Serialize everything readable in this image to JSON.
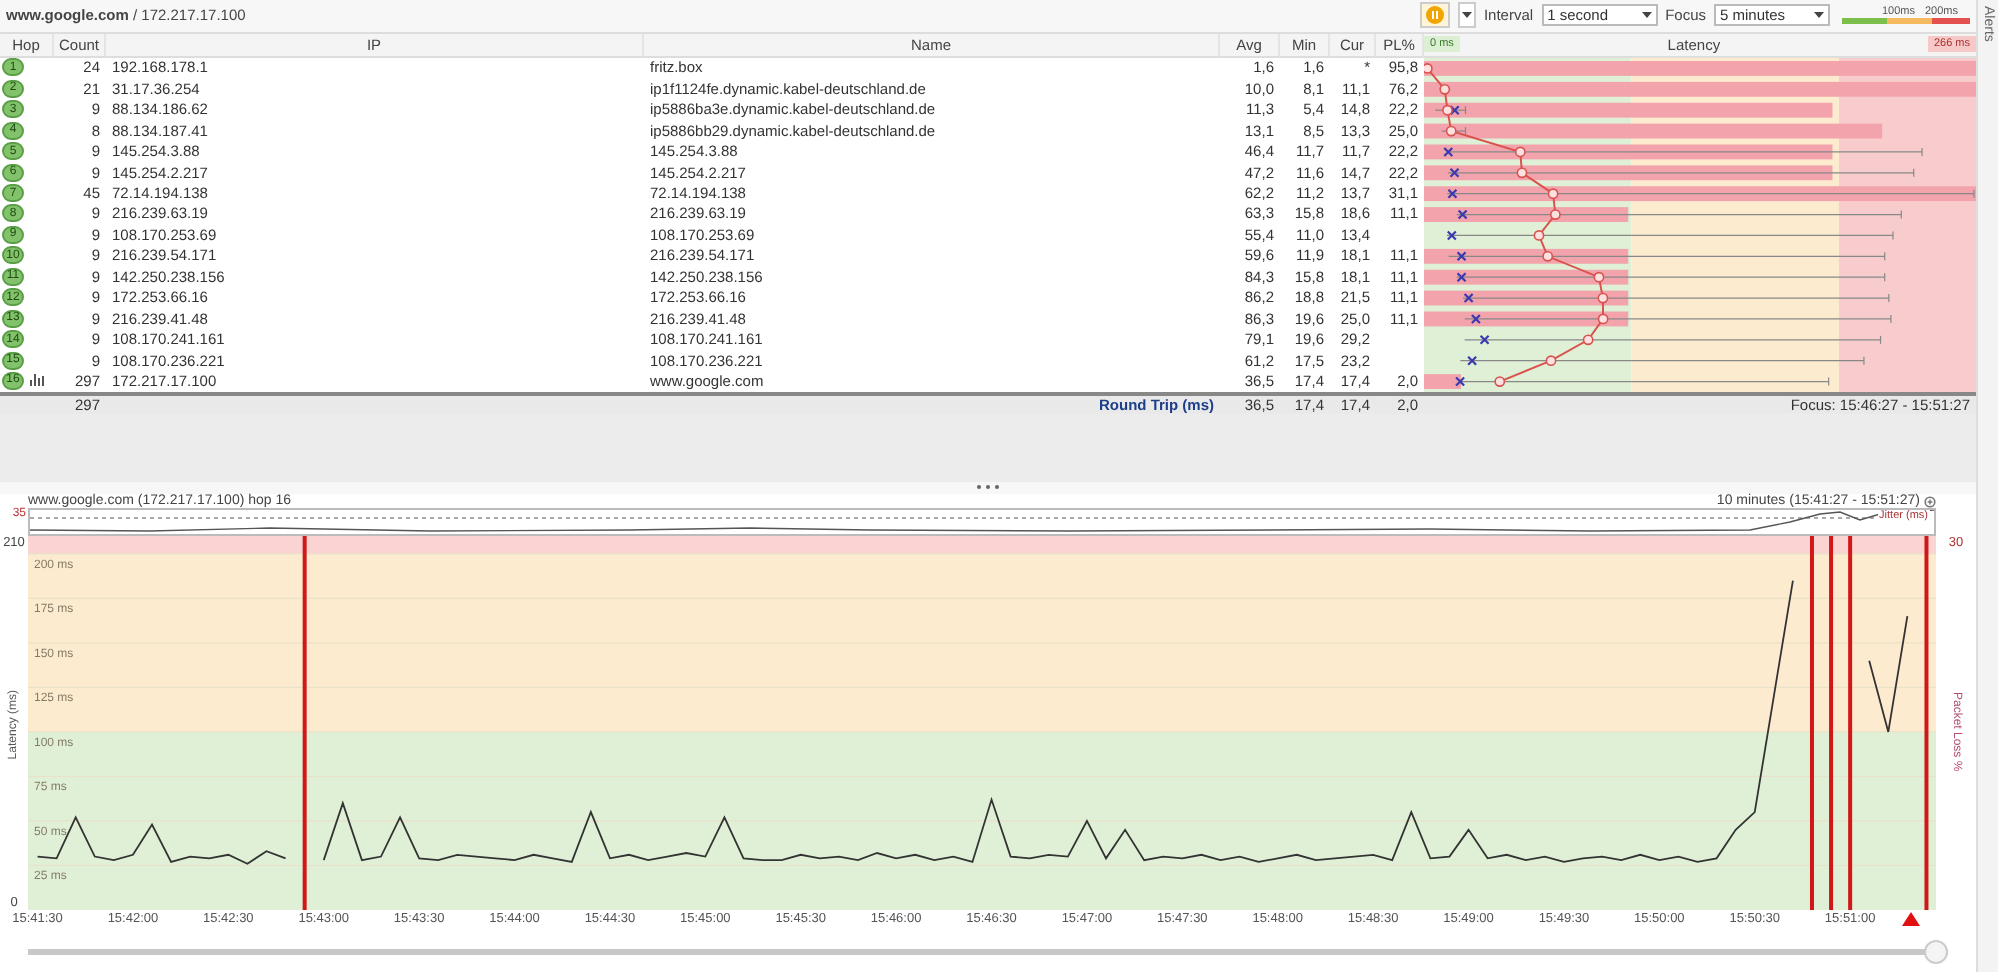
{
  "header": {
    "title": "**www.google.com** / 172.217.17.100",
    "interval_label": "Interval",
    "interval": "1 second",
    "focus_label": "Focus",
    "focus": "5 minutes",
    "legend": [
      "100ms",
      "200ms"
    ]
  },
  "alerts": "Alerts",
  "table": {
    "columns": [
      "Hop",
      "Count",
      "IP",
      "Name",
      "Avg",
      "Min",
      "Cur",
      "PL%"
    ],
    "rows": [
      {
        "hop": "1",
        "count": "24",
        "ip": "192.168.178.1",
        "name": "fritz.box",
        "avg": "1,6",
        "min": "1,6",
        "cur": "*",
        "pl": "95,8",
        "level": 1,
        "graphed": false
      },
      {
        "hop": "2",
        "count": "21",
        "ip": "31.17.36.254",
        "name": "ip1f1124fe.dynamic.kabel-deutschland.de",
        "avg": "10,0",
        "min": "8,1",
        "cur": "11,1",
        "pl": "76,2",
        "level": 1,
        "graphed": false
      },
      {
        "hop": "3",
        "count": "9",
        "ip": "88.134.186.62",
        "name": "ip5886ba3e.dynamic.kabel-deutschland.de",
        "avg": "11,3",
        "min": "5,4",
        "cur": "14,8",
        "pl": "22,2",
        "level": 0.74,
        "graphed": false
      },
      {
        "hop": "4",
        "count": "8",
        "ip": "88.134.187.41",
        "name": "ip5886bb29.dynamic.kabel-deutschland.de",
        "avg": "13,1",
        "min": "8,5",
        "cur": "13,3",
        "pl": "25,0",
        "level": 0.83,
        "graphed": false
      },
      {
        "hop": "5",
        "count": "9",
        "ip": "145.254.3.88",
        "name": "145.254.3.88",
        "avg": "46,4",
        "min": "11,7",
        "cur": "11,7",
        "pl": "22,2",
        "level": 0.74,
        "graphed": false
      },
      {
        "hop": "6",
        "count": "9",
        "ip": "145.254.2.217",
        "name": "145.254.2.217",
        "avg": "47,2",
        "min": "11,6",
        "cur": "14,7",
        "pl": "22,2",
        "level": 0.74,
        "graphed": false
      },
      {
        "hop": "7",
        "count": "45",
        "ip": "72.14.194.138",
        "name": "72.14.194.138",
        "avg": "62,2",
        "min": "11,2",
        "cur": "13,7",
        "pl": "31,1",
        "level": 1,
        "graphed": false
      },
      {
        "hop": "8",
        "count": "9",
        "ip": "216.239.63.19",
        "name": "216.239.63.19",
        "avg": "63,3",
        "min": "15,8",
        "cur": "18,6",
        "pl": "11,1",
        "level": 0.37,
        "graphed": false
      },
      {
        "hop": "9",
        "count": "9",
        "ip": "108.170.253.69",
        "name": "108.170.253.69",
        "avg": "55,4",
        "min": "11,0",
        "cur": "13,4",
        "level": 0,
        "graphed": false
      },
      {
        "hop": "10",
        "count": "9",
        "ip": "216.239.54.171",
        "name": "216.239.54.171",
        "avg": "59,6",
        "min": "11,9",
        "cur": "18,1",
        "pl": "11,1",
        "level": 0.37,
        "graphed": false
      },
      {
        "hop": "11",
        "count": "9",
        "ip": "142.250.238.156",
        "name": "142.250.238.156",
        "avg": "84,3",
        "min": "15,8",
        "cur": "18,1",
        "pl": "11,1",
        "level": 0.37,
        "graphed": false
      },
      {
        "hop": "12",
        "count": "9",
        "ip": "172.253.66.16",
        "name": "172.253.66.16",
        "avg": "86,2",
        "min": "18,8",
        "cur": "21,5",
        "pl": "11,1",
        "level": 0.37,
        "graphed": false
      },
      {
        "hop": "13",
        "count": "9",
        "ip": "216.239.41.48",
        "name": "216.239.41.48",
        "avg": "86,3",
        "min": "19,6",
        "cur": "25,0",
        "pl": "11,1",
        "level": 0.37,
        "graphed": false
      },
      {
        "hop": "14",
        "count": "9",
        "ip": "108.170.241.161",
        "name": "108.170.241.161",
        "avg": "79,1",
        "min": "19,6",
        "cur": "29,2",
        "level": 0,
        "graphed": false
      },
      {
        "hop": "15",
        "count": "9",
        "ip": "108.170.236.221",
        "name": "108.170.236.221",
        "avg": "61,2",
        "min": "17,5",
        "cur": "23,2",
        "level": 0,
        "graphed": false
      },
      {
        "hop": "16",
        "count": "297",
        "ip": "172.217.17.100",
        "name": "www.google.com",
        "avg": "36,5",
        "min": "17,4",
        "cur": "17,4",
        "pl": "2,0",
        "level": 0.067,
        "graphed": true
      }
    ],
    "latency_title": "Latency",
    "scale_start": "0 ms",
    "scale_end": "266 ms"
  },
  "summary": {
    "count": "297",
    "label": "Round Trip (ms)",
    "avg": "36,5",
    "min": "17,4",
    "cur": "17,4",
    "pl": "2,0",
    "focus": "Focus: 15:46:27 - 15:51:27"
  },
  "graph": {
    "title": "www.google.com (172.217.17.100) hop 16",
    "range": "10 minutes (15:41:27 - 15:51:27)",
    "jitter_label": "Jitter (ms)",
    "jitter_max": "35",
    "packet_loss_label": "Packet Loss %",
    "packet_loss_max": "30",
    "axis_max": "210",
    "axis_min": "0",
    "chart_data": {
      "type": "line",
      "ylabel": "Latency (ms)",
      "ylim": [
        0,
        210
      ],
      "grid": true,
      "yticks": [
        {
          "value": 25,
          "label": "25 ms"
        },
        {
          "value": 50,
          "label": "50 ms"
        },
        {
          "value": 75,
          "label": "75 ms"
        },
        {
          "value": 100,
          "label": "100 ms"
        },
        {
          "value": 125,
          "label": "125 ms"
        },
        {
          "value": 150,
          "label": "150 ms"
        },
        {
          "value": 175,
          "label": "175 ms"
        },
        {
          "value": 200,
          "label": "200 ms"
        }
      ],
      "categories": [
        "15:41:30",
        null,
        null,
        null,
        null,
        "15:42:00",
        null,
        null,
        null,
        null,
        "15:42:30",
        null,
        null,
        null,
        null,
        "15:43:00",
        null,
        null,
        null,
        null,
        "15:43:30",
        null,
        null,
        null,
        null,
        "15:44:00",
        null,
        null,
        null,
        null,
        "15:44:30",
        null,
        null,
        null,
        null,
        "15:45:00",
        null,
        null,
        null,
        null,
        "15:45:30",
        null,
        null,
        null,
        null,
        "15:46:00",
        null,
        null,
        null,
        null,
        "15:46:30",
        null,
        null,
        null,
        null,
        "15:47:00",
        null,
        null,
        null,
        null,
        "15:47:30",
        null,
        null,
        null,
        null,
        "15:48:00",
        null,
        null,
        null,
        null,
        "15:48:30",
        null,
        null,
        null,
        null,
        "15:49:00",
        null,
        null,
        null,
        null,
        "15:49:30",
        null,
        null,
        null,
        null,
        "15:50:00",
        null,
        null,
        null,
        null,
        "15:50:30",
        null,
        null,
        null,
        null,
        "15:51:00",
        null,
        null,
        null,
        null
      ],
      "series": [
        {
          "color": "#333333",
          "values": [
            30,
            29,
            52,
            30,
            28,
            31,
            48,
            27,
            30,
            29,
            31,
            26,
            33,
            29,
            null,
            28,
            60,
            28,
            30,
            52,
            29,
            28,
            31,
            30,
            29,
            28,
            31,
            29,
            27,
            55,
            29,
            31,
            28,
            30,
            32,
            30,
            52,
            29,
            28,
            28,
            31,
            29,
            30,
            28,
            32,
            29,
            31,
            28,
            30,
            27,
            62,
            30,
            29,
            31,
            30,
            50,
            29,
            45,
            28,
            30,
            29,
            31,
            28,
            30,
            27,
            29,
            31,
            28,
            29,
            30,
            31,
            28,
            55,
            29,
            30,
            45,
            29,
            31,
            28,
            30,
            27,
            29,
            30,
            28,
            31,
            28,
            30,
            27,
            29,
            45,
            55,
            120,
            185,
            null,
            null,
            null,
            140,
            100,
            165,
            null
          ]
        }
      ]
    }
  }
}
